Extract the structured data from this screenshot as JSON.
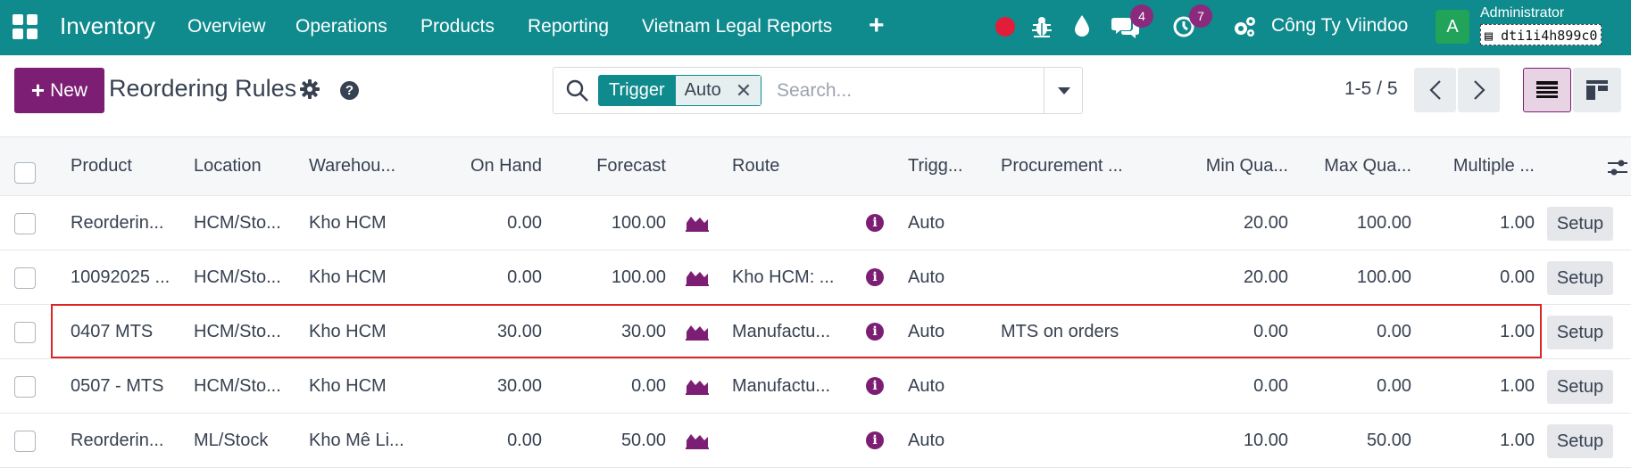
{
  "navbar": {
    "brand": "Inventory",
    "menu": [
      "Overview",
      "Operations",
      "Products",
      "Reporting",
      "Vietnam Legal Reports"
    ],
    "plus_label": "+",
    "messages_count": "4",
    "activities_count": "7",
    "company": "Công Ty Viindoo",
    "avatar_letter": "A",
    "user_name": "Administrator",
    "database": "dti1i4h899c0"
  },
  "control_panel": {
    "new_label": "New",
    "title": "Reordering Rules",
    "facet_label": "Trigger",
    "facet_value": "Auto",
    "search_placeholder": "Search...",
    "pager": "1-5 / 5"
  },
  "table": {
    "columns": [
      "Product",
      "Location",
      "Warehou...",
      "On Hand",
      "Forecast",
      "Route",
      "Trigg...",
      "Procurement ...",
      "Min Qua...",
      "Max Qua...",
      "Multiple ..."
    ],
    "setup_label": "Setup",
    "rows": [
      {
        "product": "Reorderin...",
        "location": "HCM/Sto...",
        "warehouse": "Kho HCM",
        "on_hand": "0.00",
        "forecast": "100.00",
        "route": "",
        "trigger": "Auto",
        "procurement": "",
        "min": "20.00",
        "max": "100.00",
        "multiple": "1.00"
      },
      {
        "product": "10092025 ...",
        "location": "HCM/Sto...",
        "warehouse": "Kho HCM",
        "on_hand": "0.00",
        "forecast": "100.00",
        "route": "Kho HCM: ...",
        "trigger": "Auto",
        "procurement": "",
        "min": "20.00",
        "max": "100.00",
        "multiple": "0.00"
      },
      {
        "product": "0407 MTS",
        "location": "HCM/Sto...",
        "warehouse": "Kho HCM",
        "on_hand": "30.00",
        "forecast": "30.00",
        "route": "Manufactu...",
        "trigger": "Auto",
        "procurement": "MTS on orders",
        "min": "0.00",
        "max": "0.00",
        "multiple": "1.00"
      },
      {
        "product": "0507 - MTS",
        "location": "HCM/Sto...",
        "warehouse": "Kho HCM",
        "on_hand": "30.00",
        "forecast": "0.00",
        "route": "Manufactu...",
        "trigger": "Auto",
        "procurement": "",
        "min": "0.00",
        "max": "0.00",
        "multiple": "1.00"
      },
      {
        "product": "Reorderin...",
        "location": "ML/Stock",
        "warehouse": "Kho Mê Li...",
        "on_hand": "0.00",
        "forecast": "50.00",
        "route": "",
        "trigger": "Auto",
        "procurement": "",
        "min": "10.00",
        "max": "50.00",
        "multiple": "1.00"
      }
    ]
  },
  "colors": {
    "navbar": "#0f8a8d",
    "primary": "#7c1f74",
    "highlight_border": "#dc2626"
  }
}
